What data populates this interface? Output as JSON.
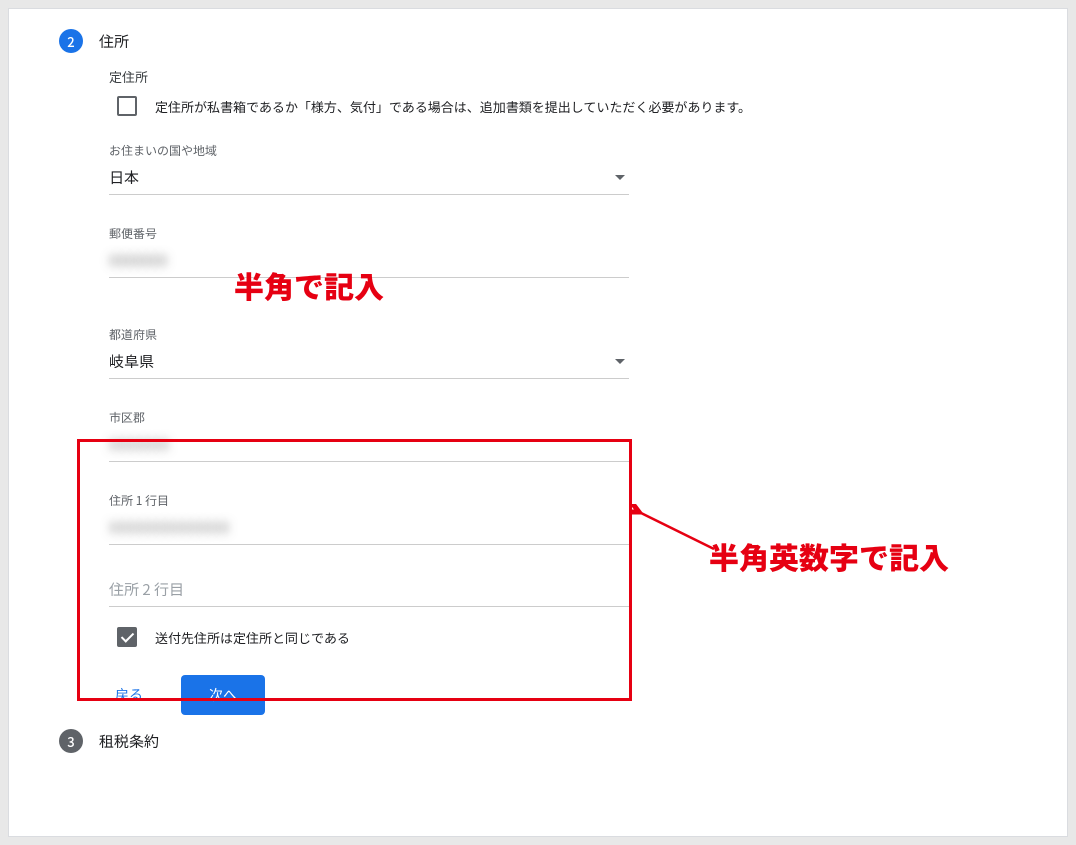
{
  "steps": {
    "s2": {
      "number": "2",
      "title": "住所"
    },
    "s3": {
      "number": "3",
      "title": "租税条約"
    }
  },
  "address": {
    "permanent_heading": "定住所",
    "pobox_note": "定住所が私書箱であるか「様方、気付」である場合は、追加書類を提出していただく必要があります。",
    "country_label": "お住まいの国や地域",
    "country_value": "日本",
    "postal_label": "郵便番号",
    "postal_value": "0000000",
    "prefecture_label": "都道府県",
    "prefecture_value": "岐阜県",
    "city_label": "市区郡",
    "city_value": "XXXXXXX",
    "line1_label": "住所 1 行目",
    "line1_value": "XXXXXXXXXXXXXX",
    "line2_placeholder": "住所 2 行目",
    "same_as_permanent": "送付先住所は定住所と同じである"
  },
  "buttons": {
    "back": "戻る",
    "next": "次へ"
  },
  "annotations": {
    "hankaku": "半角で記入",
    "hankaku_alnum": "半角英数字で記入"
  }
}
